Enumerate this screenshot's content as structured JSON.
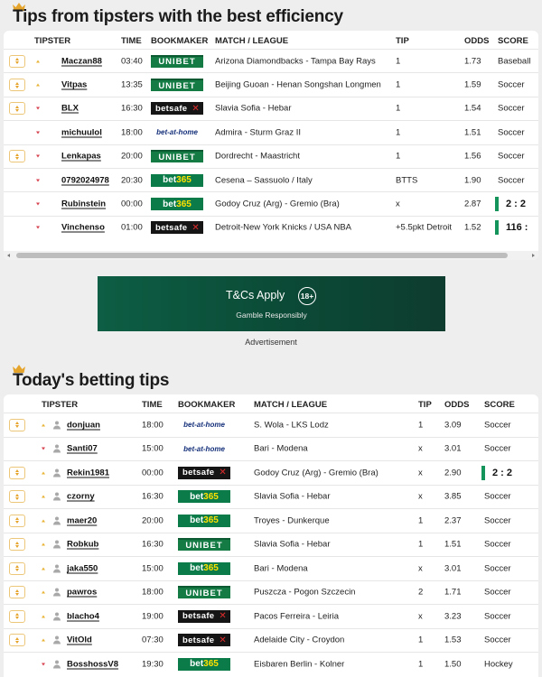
{
  "section1": {
    "title": "Tips from tipsters with the best efficiency",
    "columns": [
      "TIPSTER",
      "TIME",
      "BOOKMAKER",
      "MATCH / LEAGUE",
      "TIP",
      "ODDS",
      "SCORE"
    ],
    "rows": [
      {
        "expand": true,
        "trend": "up",
        "avatar": false,
        "tipster": "Maczan88",
        "time": "03:40",
        "bookmaker": "unibet",
        "match": "Arizona Diamondbacks - Tampa Bay Rays",
        "tip": "1",
        "odds": "1.73",
        "score": "Baseball",
        "scoreLive": false
      },
      {
        "expand": true,
        "trend": "up",
        "avatar": false,
        "tipster": "Vitpas",
        "time": "13:35",
        "bookmaker": "unibet",
        "match": "Beijing Guoan - Henan Songshan Longmen",
        "tip": "1",
        "odds": "1.59",
        "score": "Soccer",
        "scoreLive": false
      },
      {
        "expand": true,
        "trend": "down",
        "avatar": false,
        "tipster": "BLX",
        "time": "16:30",
        "bookmaker": "betsafe",
        "match": "Slavia Sofia - Hebar",
        "tip": "1",
        "odds": "1.54",
        "score": "Soccer",
        "scoreLive": false
      },
      {
        "expand": false,
        "trend": "down",
        "avatar": false,
        "tipster": "michuulol",
        "time": "18:00",
        "bookmaker": "betathome",
        "match": "Admira - Sturm Graz II",
        "tip": "1",
        "odds": "1.51",
        "score": "Soccer",
        "scoreLive": false
      },
      {
        "expand": true,
        "trend": "down",
        "avatar": false,
        "tipster": "Lenkapas",
        "time": "20:00",
        "bookmaker": "unibet",
        "match": "Dordrecht - Maastricht",
        "tip": "1",
        "odds": "1.56",
        "score": "Soccer",
        "scoreLive": false
      },
      {
        "expand": false,
        "trend": "down",
        "avatar": false,
        "tipster": "0792024978",
        "time": "20:30",
        "bookmaker": "bet365",
        "match": "Cesena – Sassuolo / Italy",
        "tip": "BTTS",
        "odds": "1.90",
        "score": "Soccer",
        "scoreLive": false
      },
      {
        "expand": false,
        "trend": "down",
        "avatar": false,
        "tipster": "Rubinstein",
        "time": "00:00",
        "bookmaker": "bet365",
        "match": "Godoy Cruz (Arg) - Gremio (Bra)",
        "tip": "x",
        "odds": "2.87",
        "score": "2 : 2",
        "scoreLive": true
      },
      {
        "expand": false,
        "trend": "down",
        "avatar": false,
        "tipster": "Vinchenso",
        "time": "01:00",
        "bookmaker": "betsafe",
        "match": "Detroit-New York Knicks / USA NBA",
        "tip": "+5.5pkt Detroit",
        "odds": "1.52",
        "score": "116 :",
        "scoreLive": true
      }
    ]
  },
  "bookmakers": {
    "unibet": "UNIBET",
    "bet365_a": "bet",
    "bet365_b": "365",
    "betsafe": "betsafe",
    "betathome": "bet-at-home"
  },
  "ad": {
    "title": "T&Cs Apply",
    "badge": "18+",
    "subtitle": "Gamble Responsibly",
    "label": "Advertisement"
  },
  "section2": {
    "title": "Today's betting tips",
    "columns": [
      "TIPSTER",
      "TIME",
      "BOOKMAKER",
      "MATCH / LEAGUE",
      "TIP",
      "ODDS",
      "SCORE"
    ],
    "rows": [
      {
        "expand": true,
        "trend": "up",
        "avatar": true,
        "tipster": "donjuan",
        "time": "18:00",
        "bookmaker": "betathome",
        "match": "S. Wola - LKS Lodz",
        "tip": "1",
        "odds": "3.09",
        "score": "Soccer",
        "scoreLive": false
      },
      {
        "expand": false,
        "trend": "down",
        "avatar": true,
        "tipster": "Santi07",
        "time": "15:00",
        "bookmaker": "betathome",
        "match": "Bari - Modena",
        "tip": "x",
        "odds": "3.01",
        "score": "Soccer",
        "scoreLive": false
      },
      {
        "expand": true,
        "trend": "up",
        "avatar": true,
        "tipster": "Rekin1981",
        "time": "00:00",
        "bookmaker": "betsafe",
        "match": "Godoy Cruz (Arg) - Gremio (Bra)",
        "tip": "x",
        "odds": "2.90",
        "score": "2 : 2",
        "scoreLive": true
      },
      {
        "expand": true,
        "trend": "up",
        "avatar": true,
        "tipster": "czorny",
        "time": "16:30",
        "bookmaker": "bet365",
        "match": "Slavia Sofia - Hebar",
        "tip": "x",
        "odds": "3.85",
        "score": "Soccer",
        "scoreLive": false
      },
      {
        "expand": true,
        "trend": "up",
        "avatar": true,
        "tipster": "maer20",
        "time": "20:00",
        "bookmaker": "bet365",
        "match": "Troyes - Dunkerque",
        "tip": "1",
        "odds": "2.37",
        "score": "Soccer",
        "scoreLive": false
      },
      {
        "expand": true,
        "trend": "up",
        "avatar": true,
        "tipster": "Robkub",
        "time": "16:30",
        "bookmaker": "unibet",
        "match": "Slavia Sofia - Hebar",
        "tip": "1",
        "odds": "1.51",
        "score": "Soccer",
        "scoreLive": false
      },
      {
        "expand": true,
        "trend": "up",
        "avatar": true,
        "tipster": "jaka550",
        "time": "15:00",
        "bookmaker": "bet365",
        "match": "Bari - Modena",
        "tip": "x",
        "odds": "3.01",
        "score": "Soccer",
        "scoreLive": false
      },
      {
        "expand": true,
        "trend": "up",
        "avatar": true,
        "tipster": "pawros",
        "time": "18:00",
        "bookmaker": "unibet",
        "match": "Puszcza - Pogon Szczecin",
        "tip": "2",
        "odds": "1.71",
        "score": "Soccer",
        "scoreLive": false
      },
      {
        "expand": true,
        "trend": "up",
        "avatar": true,
        "tipster": "blacho4",
        "time": "19:00",
        "bookmaker": "betsafe",
        "match": "Pacos Ferreira - Leiria",
        "tip": "x",
        "odds": "3.23",
        "score": "Soccer",
        "scoreLive": false
      },
      {
        "expand": true,
        "trend": "up",
        "avatar": true,
        "tipster": "VitOld",
        "time": "07:30",
        "bookmaker": "betsafe",
        "match": "Adelaide City - Croydon",
        "tip": "1",
        "odds": "1.53",
        "score": "Soccer",
        "scoreLive": false
      },
      {
        "expand": false,
        "trend": "down",
        "avatar": true,
        "tipster": "BosshossV8",
        "time": "19:30",
        "bookmaker": "bet365",
        "match": "Eisbaren Berlin - Kolner",
        "tip": "1",
        "odds": "1.50",
        "score": "Hockey",
        "scoreLive": false
      }
    ]
  },
  "colors": {
    "accent_gold": "#e5a42b",
    "trend_down": "#d6424e",
    "live_bar": "#14935b",
    "unibet": "#147b45",
    "bet365": "#0b7b4a",
    "betsafe": "#151515",
    "ad_bg": "#0b4a36"
  }
}
